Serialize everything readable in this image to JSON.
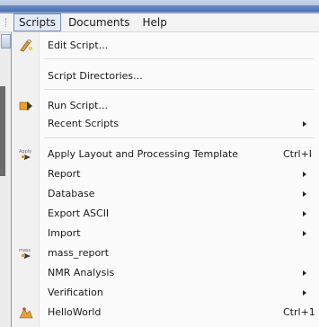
{
  "menubar": {
    "items": [
      {
        "label": "Scripts",
        "active": true
      },
      {
        "label": "Documents",
        "active": false
      },
      {
        "label": "Help",
        "active": false
      }
    ]
  },
  "scripts_menu": {
    "edit_script": "Edit Script...",
    "script_directories": "Script Directories...",
    "run_script": "Run Script...",
    "recent_scripts": "Recent Scripts",
    "apply_layout": {
      "label": "Apply Layout and Processing Template",
      "shortcut": "Ctrl+I"
    },
    "report": "Report",
    "database": "Database",
    "export_ascii": "Export ASCII",
    "import": "Import",
    "mass_report": "mass_report",
    "nmr_analysis": "NMR Analysis",
    "verification": "Verification",
    "helloworld": {
      "label": "HelloWorld",
      "shortcut": "Ctrl+1"
    }
  },
  "icons": {
    "edit_script": "script-edit-icon",
    "run_script": "run-script-icon",
    "apply_layout": "apply-template-icon",
    "mass_report": "mass-report-icon",
    "helloworld": "hello-world-icon"
  }
}
